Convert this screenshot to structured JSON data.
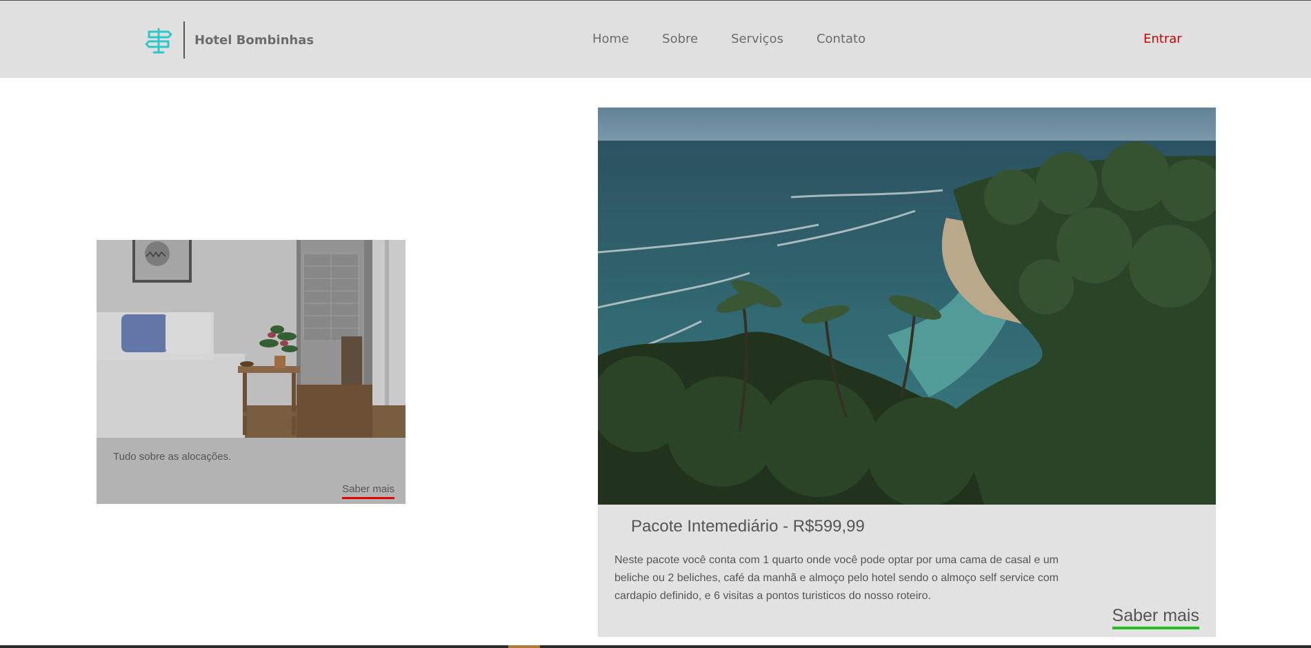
{
  "header": {
    "brand_name": "Hotel Bombinhas",
    "logo_icon": "signpost-icon",
    "nav": [
      "Home",
      "Sobre",
      "Serviços",
      "Contato"
    ],
    "login_label": "Entrar",
    "accent_color": "#c40000",
    "logo_color": "#2ec7c7"
  },
  "cards": {
    "allocations": {
      "image": "bedroom-photo",
      "text": "Tudo sobre as alocações.",
      "more_label": "Saber mais",
      "underline_color": "#e00000"
    },
    "package": {
      "image": "beach-forest-photo",
      "title": "Pacote Intemediário - R$599,99",
      "description": "Neste pacote você conta com 1 quarto onde você pode optar por uma cama de casal e um beliche ou 2 beliches, café da manhã e almoço pelo hotel sendo o almoço self service com cardapio definido, e 6 visitas a pontos turisticos do nosso roteiro.",
      "more_label": "Saber mais",
      "underline_color": "#22c122"
    }
  }
}
